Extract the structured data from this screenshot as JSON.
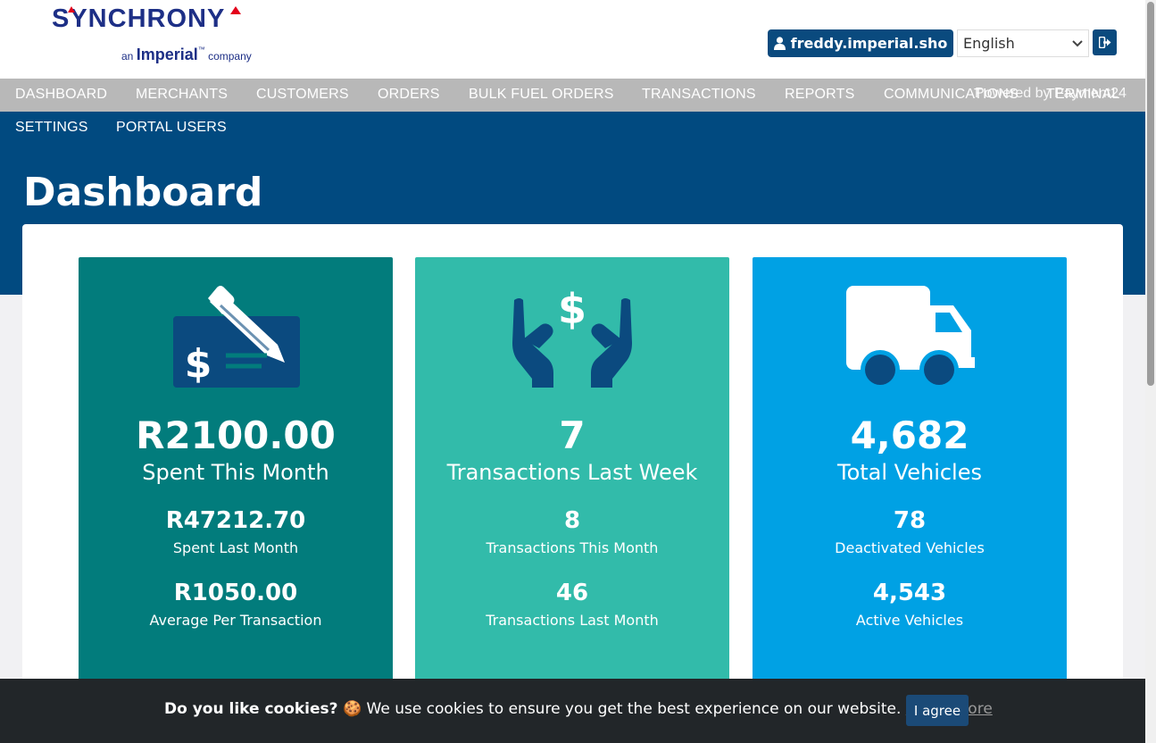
{
  "brand": {
    "name": "SYNCHRONY",
    "sub_prefix": "an",
    "sub_brand": "Imperial",
    "sub_tm": "™",
    "sub_suffix": "company"
  },
  "header": {
    "username": "freddy.imperial.sho",
    "language": "English",
    "logout_icon": "sign-out-icon"
  },
  "nav": {
    "row1": [
      "DASHBOARD",
      "MERCHANTS",
      "CUSTOMERS",
      "ORDERS",
      "BULK FUEL ORDERS",
      "TRANSACTIONS",
      "REPORTS",
      "COMMUNICATIONS",
      "TERMINAL"
    ],
    "row2": [
      "SETTINGS",
      "PORTAL USERS"
    ],
    "powered_by": "Powered by Payment24"
  },
  "page": {
    "title": "Dashboard"
  },
  "cards": [
    {
      "icon": "cheque-pen-icon",
      "color": "#027c7c",
      "main_value": "R2100.00",
      "main_label": "Spent This Month",
      "stat1_value": "R47212.70",
      "stat1_label": "Spent Last Month",
      "stat2_value": "R1050.00",
      "stat2_label": "Average Per Transaction"
    },
    {
      "icon": "hands-dollar-icon",
      "color": "#32bbaa",
      "main_value": "7",
      "main_label": "Transactions Last Week",
      "stat1_value": "8",
      "stat1_label": "Transactions This Month",
      "stat2_value": "46",
      "stat2_label": "Transactions Last Month"
    },
    {
      "icon": "truck-icon",
      "color": "#00a1e4",
      "main_value": "4,682",
      "main_label": "Total Vehicles",
      "stat1_value": "78",
      "stat1_label": "Deactivated Vehicles",
      "stat2_value": "4,543",
      "stat2_label": "Active Vehicles"
    }
  ],
  "cookie": {
    "question": "Do you like cookies?",
    "emoji": "🍪",
    "message": "We use cookies to ensure you get the best experience on our website.",
    "learn_more": "Learn more",
    "agree": "I agree"
  },
  "colors": {
    "navy": "#014a80",
    "button": "#0a4a7e",
    "nav_gray": "#b8b8b8",
    "icon_dark": "#0b4a7f"
  }
}
